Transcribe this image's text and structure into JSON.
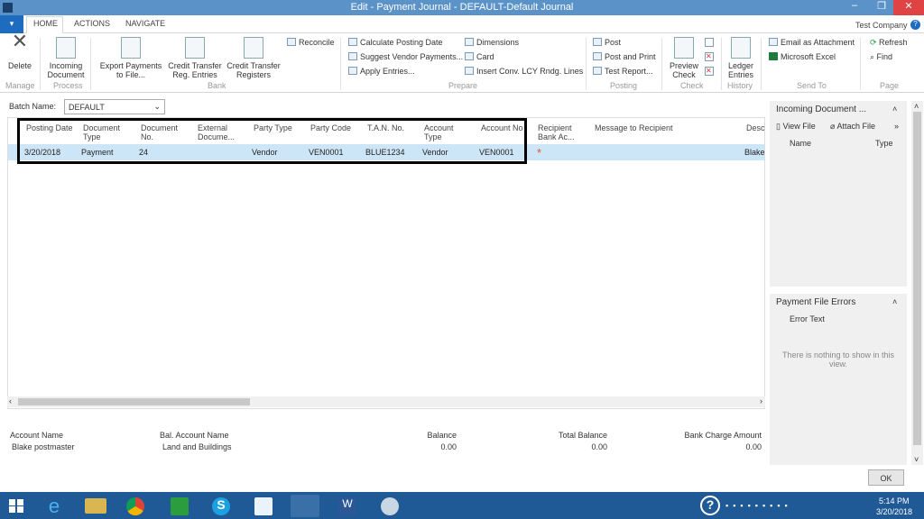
{
  "window": {
    "title": "Edit - Payment Journal - DEFAULT-Default Journal",
    "company": "Test Company"
  },
  "tabs": [
    "HOME",
    "ACTIONS",
    "NAVIGATE"
  ],
  "ribbon": {
    "delete": "Delete",
    "incoming": "Incoming Document",
    "export": "Export Payments to File...",
    "ct_reg": "Credit Transfer Reg. Entries",
    "ct_registers": "Credit Transfer Registers",
    "reconcile": "Reconcile",
    "calc": "Calculate Posting Date",
    "suggest": "Suggest Vendor Payments...",
    "apply": "Apply Entries...",
    "dimensions": "Dimensions",
    "card": "Card",
    "insert": "Insert Conv. LCY Rndg. Lines",
    "post": "Post",
    "post_print": "Post and Print",
    "test": "Test Report...",
    "preview": "Preview Check",
    "ledger": "Ledger Entries",
    "email": "Email as Attachment",
    "excel": "Microsoft Excel",
    "refresh": "Refresh",
    "find": "Find",
    "groups": {
      "manage": "Manage",
      "process": "Process",
      "bank": "Bank",
      "prepare": "Prepare",
      "posting": "Posting",
      "check": "Check",
      "history": "History",
      "send": "Send To",
      "page": "Page"
    }
  },
  "batch": {
    "label": "Batch Name:",
    "value": "DEFAULT"
  },
  "grid": {
    "headers": [
      "Posting Date",
      "Document Type",
      "Document No.",
      "External Docume...",
      "Party Type",
      "Party Code",
      "T.A.N. No.",
      "Account Type",
      "Account No",
      "Recipient Bank Ac...",
      "Message to Recipient",
      "Desc"
    ],
    "row": [
      "3/20/2018",
      "Payment",
      "24",
      "",
      "Vendor",
      "VEN0001",
      "BLUE1234",
      "Vendor",
      "VEN0001",
      "*",
      "",
      "Blake"
    ]
  },
  "factbox": {
    "incoming_title": "Incoming Document ...",
    "view_file": "View File",
    "attach_file": "Attach File",
    "name": "Name",
    "type": "Type",
    "errors_title": "Payment File Errors",
    "error_text": "Error Text",
    "empty": "There is nothing to show in this view."
  },
  "footer": {
    "account_name_label": "Account Name",
    "account_name": "Blake postmaster",
    "bal_label": "Bal. Account Name",
    "bal": "Land and Buildings",
    "balance_label": "Balance",
    "balance": "0.00",
    "total_label": "Total Balance",
    "total": "0.00",
    "charge_label": "Bank Charge Amount",
    "charge": "0.00",
    "ok": "OK"
  },
  "taskbar": {
    "time": "5:14 PM",
    "date": "3/20/2018"
  },
  "colors": {
    "titlebar": "#5b93c9",
    "selected_row": "#cde6f7",
    "taskbar": "#1f5a96",
    "required": "#e0503c"
  }
}
